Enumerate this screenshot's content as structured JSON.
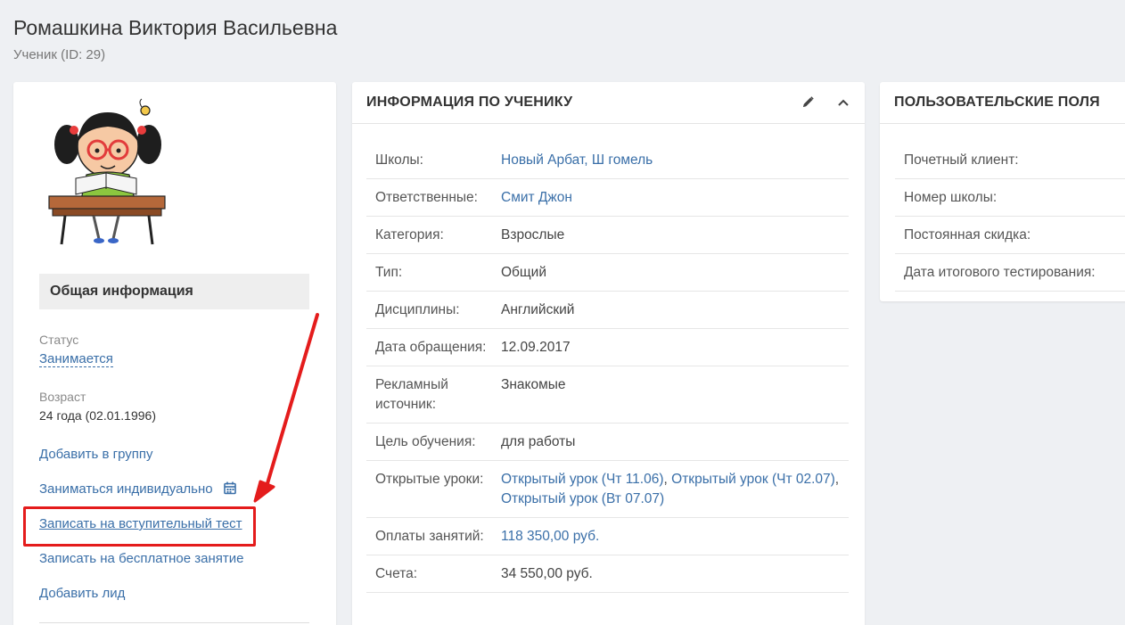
{
  "header": {
    "title": "Ромашкина Виктория Васильевна",
    "subtitle": "Ученик (ID: 29)"
  },
  "profile": {
    "section_title": "Общая информация",
    "status_label": "Статус",
    "status_value": "Занимается",
    "age_label": "Возраст",
    "age_value": "24 года (02.01.1996)",
    "actions": [
      "Добавить в группу",
      "Заниматься индивидуально",
      "Записать на вступительный тест",
      "Записать на бесплатное занятие",
      "Добавить лид"
    ]
  },
  "info_card": {
    "title": "ИНФОРМАЦИЯ ПО УЧЕНИКУ",
    "rows": [
      {
        "label": "Школы:",
        "value": "Новый Арбат, Ш гомель"
      },
      {
        "label": "Ответственные:",
        "value": "Смит Джон"
      },
      {
        "label": "Категория:",
        "value": "Взрослые"
      },
      {
        "label": "Тип:",
        "value": "Общий"
      },
      {
        "label": "Дисциплины:",
        "value": "Английский"
      },
      {
        "label": "Дата обращения:",
        "value": "12.09.2017"
      },
      {
        "label": "Рекламный источник:",
        "value": "Знакомые"
      },
      {
        "label": "Цель обучения:",
        "value": "для работы"
      },
      {
        "label": "Открытые уроки:",
        "links": [
          "Открытый урок (Чт 11.06)",
          "Открытый урок (Чт 02.07)",
          "Открытый урок (Вт 07.07)"
        ],
        "separator": ", "
      },
      {
        "label": "Оплаты занятий:",
        "value": "118 350,00 руб."
      },
      {
        "label": "Счета:",
        "value": "34 550,00 руб."
      }
    ]
  },
  "custom_fields": {
    "title": "ПОЛЬЗОВАТЕЛЬСКИЕ ПОЛЯ",
    "rows": [
      "Почетный клиент:",
      "Номер школы:",
      "Постоянная скидка:",
      "Дата итогового тестирования:"
    ]
  },
  "colors": {
    "link": "#3a6fa8",
    "highlight": "#e41c1c",
    "background": "#eef0f3"
  },
  "icons": {
    "edit": "pencil-icon",
    "collapse": "chevron-up-icon",
    "calendar": "calendar-icon"
  }
}
